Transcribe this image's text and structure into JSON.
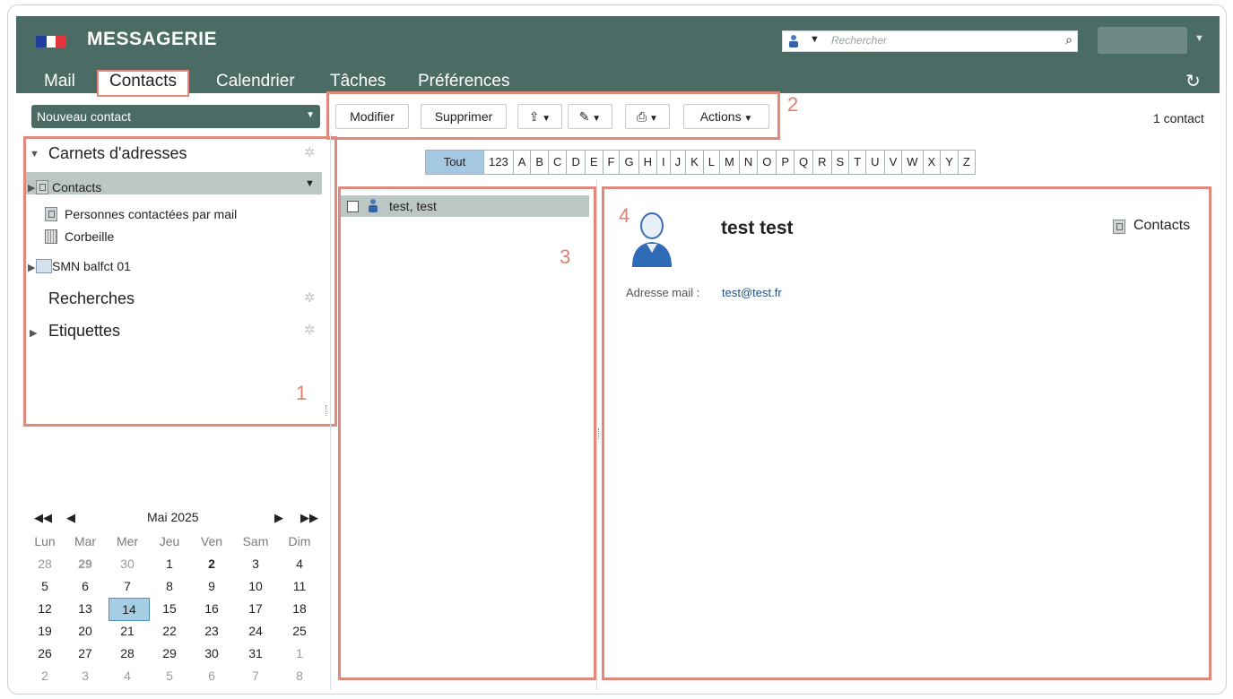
{
  "app": {
    "title": "MESSAGERIE"
  },
  "search": {
    "placeholder": "Rechercher"
  },
  "tabs": [
    {
      "label": "Mail",
      "active": false
    },
    {
      "label": "Contacts",
      "active": true
    },
    {
      "label": "Calendrier",
      "active": false
    },
    {
      "label": "Tâches",
      "active": false
    },
    {
      "label": "Préférences",
      "active": false
    }
  ],
  "left": {
    "new_contact": "Nouveau contact",
    "address_books_title": "Carnets d'adresses",
    "items": [
      "Contacts",
      "Personnes contactées par mail",
      "Corbeille",
      "SMN balfct 01"
    ],
    "searches_title": "Recherches",
    "labels_title": "Etiquettes"
  },
  "toolbar": {
    "edit": "Modifier",
    "delete": "Supprimer",
    "actions": "Actions",
    "count": "1 contact"
  },
  "alphabet": [
    "Tout",
    "123",
    "A",
    "B",
    "C",
    "D",
    "E",
    "F",
    "G",
    "H",
    "I",
    "J",
    "K",
    "L",
    "M",
    "N",
    "O",
    "P",
    "Q",
    "R",
    "S",
    "T",
    "U",
    "V",
    "W",
    "X",
    "Y",
    "Z"
  ],
  "list": {
    "items": [
      "test, test"
    ]
  },
  "contact": {
    "name": "test test",
    "book": "Contacts",
    "email_label": "Adresse mail :",
    "email": "test@test.fr"
  },
  "annotations": {
    "n1": "1",
    "n2": "2",
    "n3": "3",
    "n4": "4"
  },
  "calendar": {
    "month": "Mai 2025",
    "days": [
      "Lun",
      "Mar",
      "Mer",
      "Jeu",
      "Ven",
      "Sam",
      "Dim"
    ],
    "weeks": [
      [
        "28",
        "29",
        "30",
        "1",
        "2",
        "3",
        "4"
      ],
      [
        "5",
        "6",
        "7",
        "8",
        "9",
        "10",
        "11"
      ],
      [
        "12",
        "13",
        "14",
        "15",
        "16",
        "17",
        "18"
      ],
      [
        "19",
        "20",
        "21",
        "22",
        "23",
        "24",
        "25"
      ],
      [
        "26",
        "27",
        "28",
        "29",
        "30",
        "31",
        "1"
      ],
      [
        "2",
        "3",
        "4",
        "5",
        "6",
        "7",
        "8"
      ]
    ],
    "today": "14"
  },
  "colors": {
    "header": "#4b6c64",
    "highlight": "#e0897c",
    "selection": "#bcc6c4",
    "today": "#a5cde4"
  }
}
